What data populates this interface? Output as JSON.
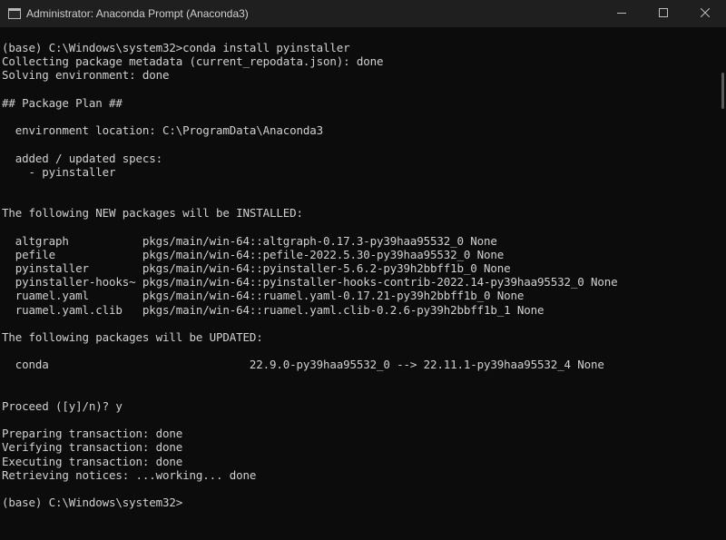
{
  "window": {
    "title": "Administrator: Anaconda Prompt (Anaconda3)",
    "controls": [
      "minimize",
      "maximize",
      "close"
    ]
  },
  "terminal": {
    "lines": [
      "(base) C:\\Windows\\system32>conda install pyinstaller",
      "Collecting package metadata (current_repodata.json): done",
      "Solving environment: done",
      "",
      "## Package Plan ##",
      "",
      "  environment location: C:\\ProgramData\\Anaconda3",
      "",
      "  added / updated specs:",
      "    - pyinstaller",
      "",
      "",
      "The following NEW packages will be INSTALLED:",
      "",
      "  altgraph           pkgs/main/win-64::altgraph-0.17.3-py39haa95532_0 None",
      "  pefile             pkgs/main/win-64::pefile-2022.5.30-py39haa95532_0 None",
      "  pyinstaller        pkgs/main/win-64::pyinstaller-5.6.2-py39h2bbff1b_0 None",
      "  pyinstaller-hooks~ pkgs/main/win-64::pyinstaller-hooks-contrib-2022.14-py39haa95532_0 None",
      "  ruamel.yaml        pkgs/main/win-64::ruamel.yaml-0.17.21-py39h2bbff1b_0 None",
      "  ruamel.yaml.clib   pkgs/main/win-64::ruamel.yaml.clib-0.2.6-py39h2bbff1b_1 None",
      "",
      "The following packages will be UPDATED:",
      "",
      "  conda                              22.9.0-py39haa95532_0 --> 22.11.1-py39haa95532_4 None",
      "",
      "",
      "Proceed ([y]/n)? y",
      "",
      "Preparing transaction: done",
      "Verifying transaction: done",
      "Executing transaction: done",
      "Retrieving notices: ...working... done",
      "",
      "(base) C:\\Windows\\system32>"
    ]
  },
  "colors": {
    "background": "#0c0c0c",
    "titlebar": "#1f1f1f",
    "text": "#d0d0d0"
  }
}
